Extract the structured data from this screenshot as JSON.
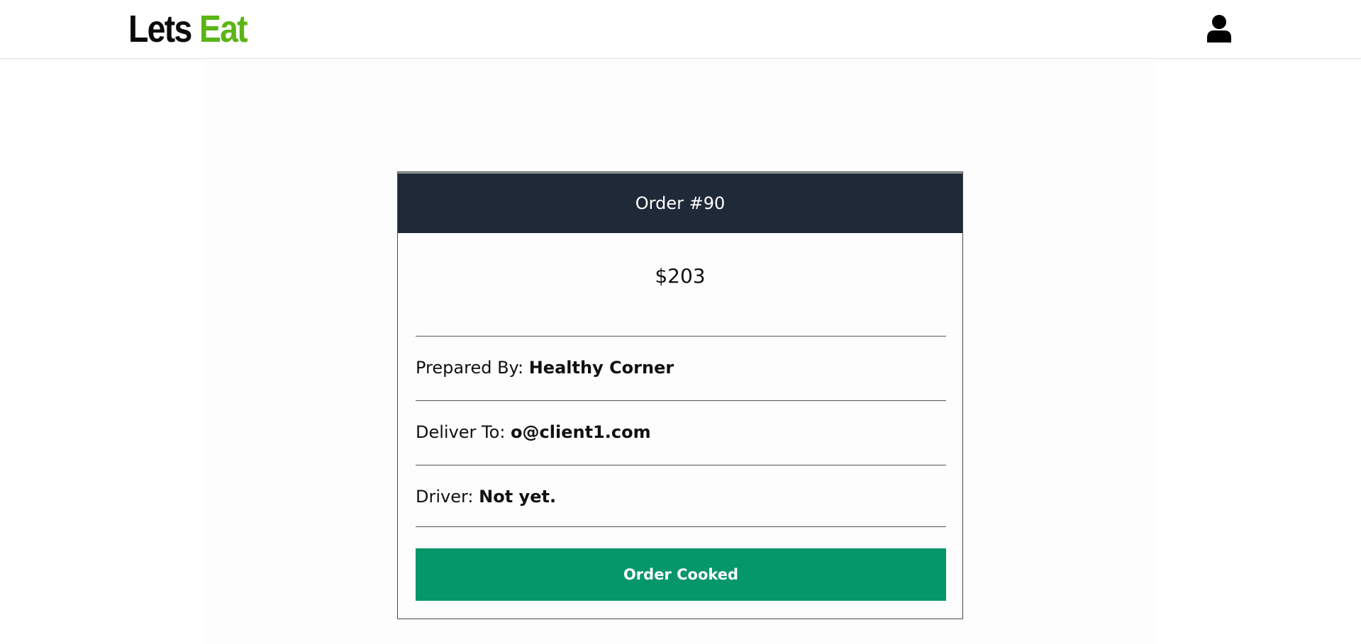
{
  "header": {
    "logo_part1": "Lets",
    "logo_part2": "Eat",
    "logo_accent_color": "#5bb515",
    "user_icon": "user-icon"
  },
  "order": {
    "title": "Order #90",
    "price": "$203",
    "prepared_by_label": "Prepared By:",
    "prepared_by_value": "Healthy Corner",
    "deliver_to_label": "Deliver To:",
    "deliver_to_value": "o@client1.com",
    "driver_label": "Driver:",
    "driver_value": "Not yet.",
    "action_label": "Order Cooked",
    "header_color": "#1f2937",
    "action_color": "#059669"
  }
}
